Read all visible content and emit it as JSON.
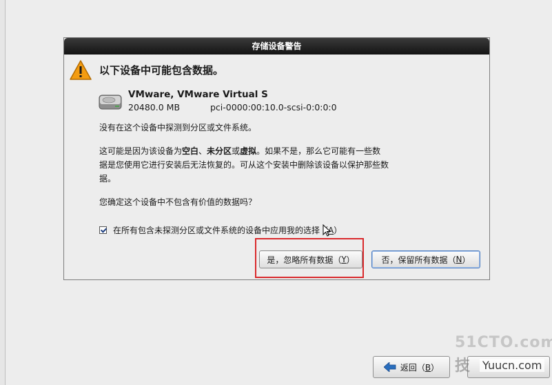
{
  "dialog": {
    "title": "存储设备警告",
    "header": "以下设备中可能包含数据。",
    "device": {
      "name": "VMware, VMware Virtual S",
      "size": "20480.0 MB",
      "path": "pci-0000:00:10.0-scsi-0:0:0:0"
    },
    "message1": "没有在这个设备中探测到分区或文件系统。",
    "message2": {
      "part1": "这可能是因为该设备为",
      "b1": "空白",
      "sep1": "、",
      "b2": "未分区",
      "sep2": "或",
      "b3": "虚拟",
      "part2": "。如果不是，那么它可能有一些数据是您使用它进行安装后无法恢复的。可从这个安装中删除该设备以保护那些数据。"
    },
    "question": "您确定这个设备中不包含有价值的数据吗？",
    "checkbox": {
      "label": "在所有包含未探测分区或文件系统的设备中应用我的选择（",
      "accel": "A",
      "label_end": "）",
      "checked": true
    },
    "buttons": {
      "yes": {
        "label": "是，忽略所有数据（",
        "accel": "Y",
        "end": "）"
      },
      "no": {
        "label": "否，保留所有数据（",
        "accel": "N",
        "end": "）"
      }
    }
  },
  "footer": {
    "back": {
      "label": "返回（",
      "accel": "B",
      "end": "）"
    }
  },
  "watermark": {
    "site": "51CTO.com",
    "brand": "Yuucn.com",
    "char": "技"
  },
  "colors": {
    "titlebar": "#141414",
    "highlight_box": "#d9282b",
    "warning": "#f39c12",
    "focus_border": "#4a7bc0"
  },
  "icons": [
    "warning-icon",
    "hard-disk-icon",
    "checkbox-checked",
    "mouse-cursor-icon",
    "back-arrow-icon"
  ]
}
